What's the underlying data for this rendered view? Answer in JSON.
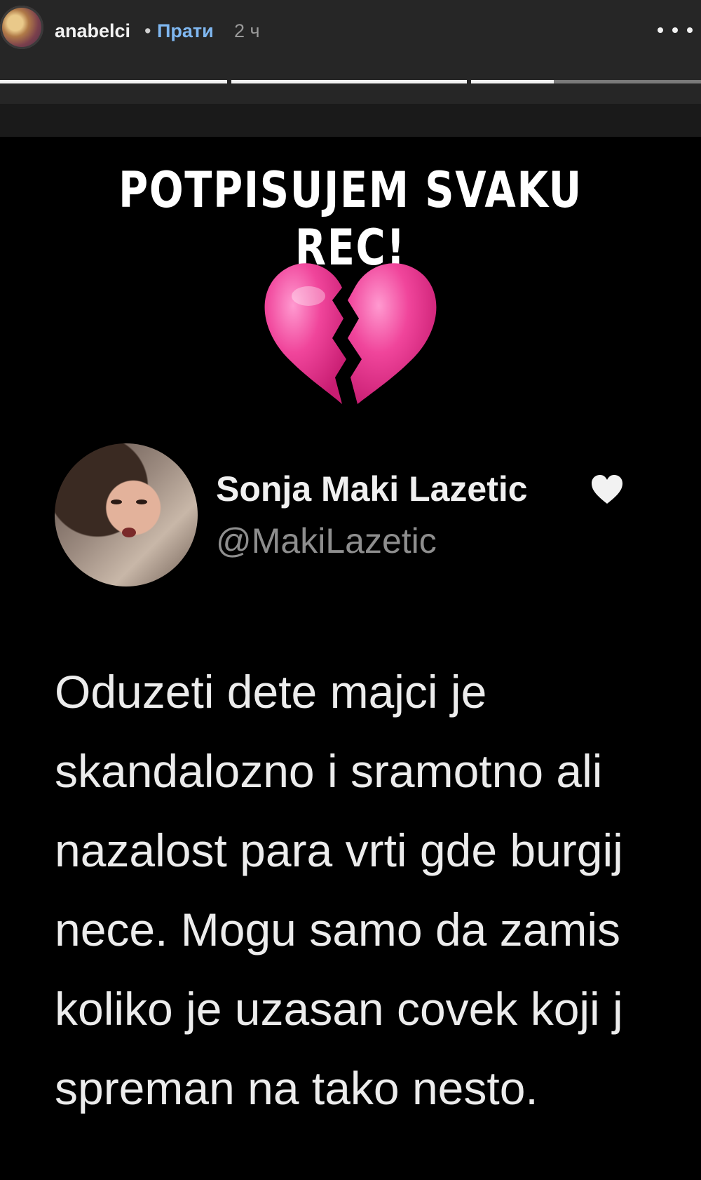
{
  "story_header": {
    "username": "anabelci",
    "separator": "•",
    "follow_label": "Прати",
    "time_ago": "2 ч",
    "progress": [
      1,
      1,
      0.36
    ]
  },
  "story": {
    "headline": "POTPISUJEM SVAKU REC!",
    "emoji": "broken-heart-icon"
  },
  "tweet": {
    "display_name": "Sonja Maki Lazetic",
    "handle": "@MakiLazetic",
    "lines": [
      "Oduzeti dete majci je",
      "skandalozno i sramotno ali",
      "nazalost para vrti gde burgij",
      "nece. Mogu samo da zamis",
      "koliko je uzasan covek koji j",
      "spreman na tako nesto."
    ]
  },
  "colors": {
    "header_bg": "#262626",
    "follow_link": "#7fb7f0",
    "broken_heart": "#f0459b",
    "handle_text": "#8e8e8e"
  }
}
